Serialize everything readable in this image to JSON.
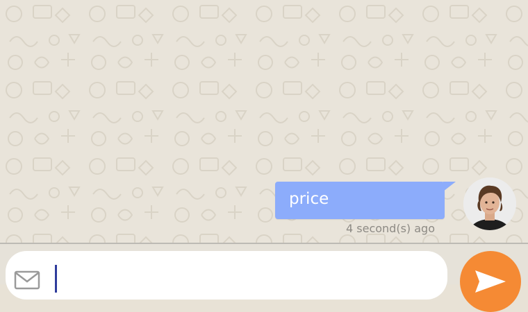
{
  "conversation": {
    "messages": [
      {
        "text": "price",
        "time": "4 second(s) ago",
        "sender": "self"
      }
    ]
  },
  "composer": {
    "value": "",
    "placeholder": "",
    "left_icon": "mail-icon",
    "send_icon": "send-arrow-icon"
  },
  "colors": {
    "chat_background": "#e9e4da",
    "bubble": "#8cacfb",
    "bubble_text": "#ffffff",
    "timestamp": "#8d8a84",
    "send_button": "#f58a34",
    "caret": "#2f3c9c"
  }
}
